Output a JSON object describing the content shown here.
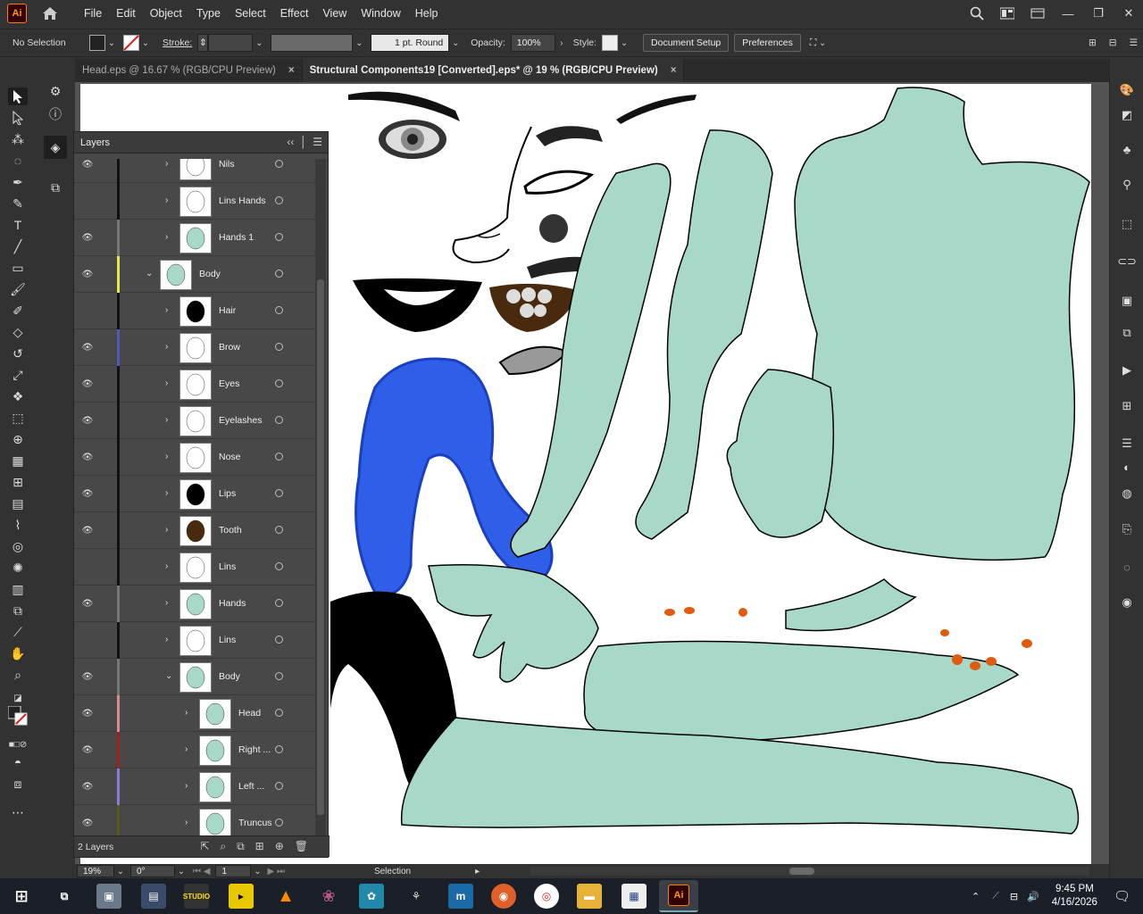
{
  "app": {
    "logo": "Ai"
  },
  "menu": [
    "File",
    "Edit",
    "Object",
    "Type",
    "Select",
    "Effect",
    "View",
    "Window",
    "Help"
  ],
  "control": {
    "selection": "No Selection",
    "stroke_label": "Stroke:",
    "brush": "1 pt. Round",
    "opacity_label": "Opacity:",
    "opacity_value": "100%",
    "style_label": "Style:",
    "document_setup": "Document Setup",
    "preferences": "Preferences"
  },
  "tabs": [
    {
      "label": "Head.eps @ 16.67 % (RGB/CPU Preview)",
      "active": false
    },
    {
      "label": "Structural Components19 [Converted].eps* @ 19 % (RGB/CPU Preview)",
      "active": true
    }
  ],
  "layers_panel": {
    "title": "Layers",
    "footer_count": "2 Layers",
    "rows": [
      {
        "name": "Nils",
        "visible": true,
        "color": "#111111",
        "indent": 1
      },
      {
        "name": "Lins Hands",
        "visible": false,
        "color": "#111111",
        "indent": 1
      },
      {
        "name": "Hands 1",
        "visible": true,
        "color": "#777777",
        "indent": 1
      },
      {
        "name": "Body",
        "visible": true,
        "color": "#e8e84a",
        "indent": 0,
        "expanded": true
      },
      {
        "name": "Hair",
        "visible": false,
        "color": "#111111",
        "indent": 1
      },
      {
        "name": "Brow",
        "visible": true,
        "color": "#4a5bb8",
        "indent": 1
      },
      {
        "name": "Eyes",
        "visible": true,
        "color": "#111111",
        "indent": 1
      },
      {
        "name": "Eyelashes",
        "visible": true,
        "color": "#111111",
        "indent": 1
      },
      {
        "name": "Nose",
        "visible": true,
        "color": "#111111",
        "indent": 1
      },
      {
        "name": "Lips",
        "visible": true,
        "color": "#111111",
        "indent": 1
      },
      {
        "name": "Tooth",
        "visible": true,
        "color": "#111111",
        "indent": 1
      },
      {
        "name": "Lins",
        "visible": false,
        "color": "#111111",
        "indent": 1
      },
      {
        "name": "Hands",
        "visible": true,
        "color": "#777777",
        "indent": 1
      },
      {
        "name": "Lins",
        "visible": false,
        "color": "#111111",
        "indent": 1
      },
      {
        "name": "Body",
        "visible": true,
        "color": "#777777",
        "indent": 1,
        "expanded": true
      },
      {
        "name": "Head",
        "visible": true,
        "color": "#d98a8a",
        "indent": 2
      },
      {
        "name": "Right ...",
        "visible": true,
        "color": "#a02020",
        "indent": 2
      },
      {
        "name": "Left ...",
        "visible": true,
        "color": "#8a7ad9",
        "indent": 2
      },
      {
        "name": "Truncus",
        "visible": true,
        "color": "#5a5a20",
        "indent": 2
      }
    ]
  },
  "status": {
    "zoom": "19%",
    "rotation": "0°",
    "page": "1",
    "tool": "Selection"
  },
  "taskbar": {
    "time": "9:45 PM",
    "date": "4/16/2026"
  },
  "colors": {
    "accent": "#ff9a00",
    "body_fill": "#a8d8c8",
    "hair_fill": "#2255dd"
  }
}
